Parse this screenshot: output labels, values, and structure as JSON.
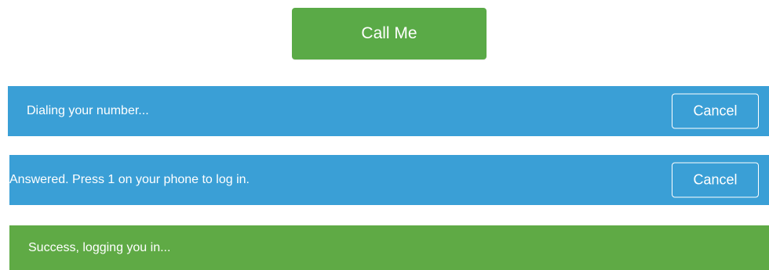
{
  "call_button": {
    "label": "Call Me"
  },
  "status_bars": [
    {
      "text": "Dialing your number...",
      "action_label": "Cancel"
    },
    {
      "text": "Answered. Press 1 on your phone to log in.",
      "action_label": "Cancel"
    },
    {
      "text": "Success, logging you in..."
    }
  ],
  "colors": {
    "primary_green": "#5aaa47",
    "info_blue": "#3a9fd6",
    "success_green": "#5faa45",
    "text_on_color": "#ffffff"
  }
}
